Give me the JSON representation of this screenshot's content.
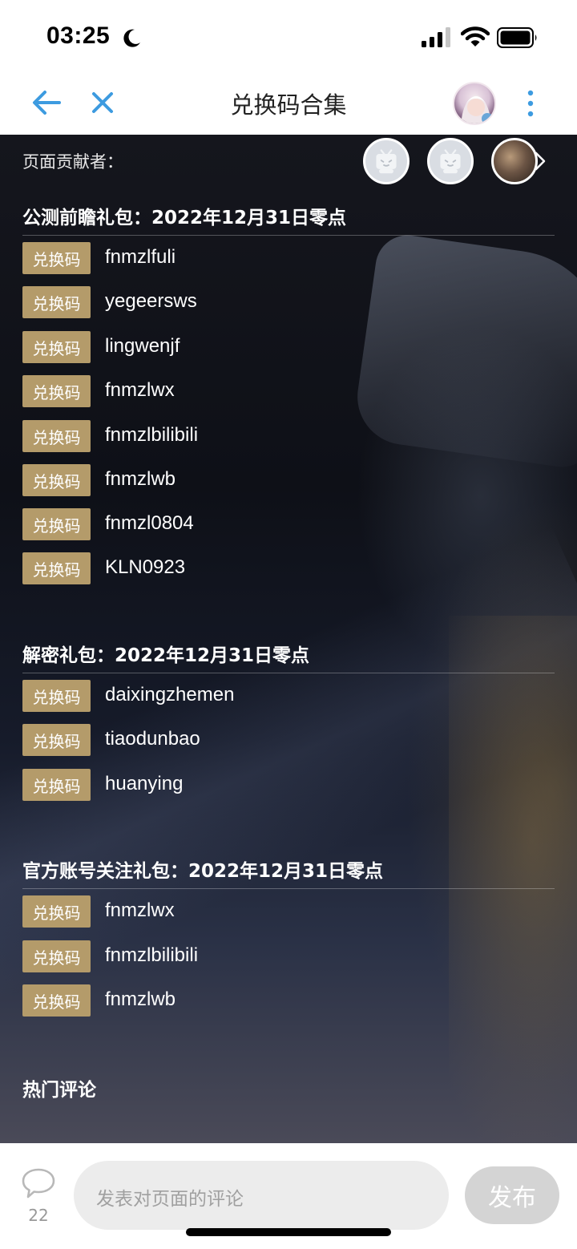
{
  "status_bar": {
    "time": "03:25"
  },
  "nav": {
    "title": "兑换码合集"
  },
  "contributors": {
    "label": "页面贡献者："
  },
  "sections": [
    {
      "title": "公测前瞻礼包：2022年12月31日零点",
      "codes": [
        "fnmzlfuli",
        "yegeersws",
        "lingwenjf",
        "fnmzlwx",
        "fnmzlbilibili",
        "fnmzlwb",
        "fnmzl0804",
        "KLN0923"
      ]
    },
    {
      "title": "解密礼包：2022年12月31日零点",
      "codes": [
        "daixingzhemen",
        "tiaodunbao",
        "huanying"
      ]
    },
    {
      "title": "官方账号关注礼包：2022年12月31日零点",
      "codes": [
        "fnmzlwx",
        "fnmzlbilibili",
        "fnmzlwb"
      ]
    }
  ],
  "badge_label": "兑换码",
  "hot_comments_title": "热门评论",
  "bottom_bar": {
    "comment_count": "22",
    "input_placeholder": "发表对页面的评论",
    "publish_label": "发布"
  },
  "colors": {
    "accent_blue": "#3d9be0",
    "badge_gold": "#b49b6a"
  }
}
